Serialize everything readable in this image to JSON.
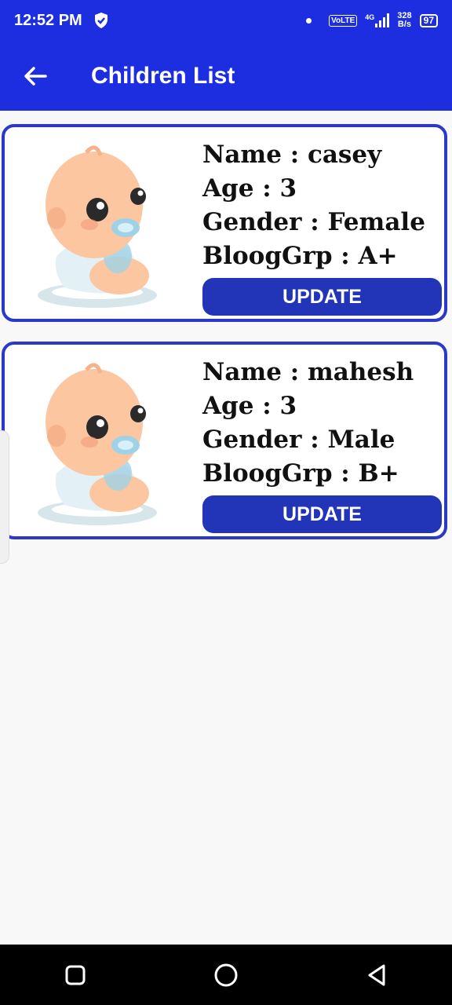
{
  "status_bar": {
    "time": "12:52 PM",
    "volte": "VoLTE",
    "signal_label": "4G",
    "net_speed_value": "328",
    "net_speed_unit": "B/s",
    "battery": "97"
  },
  "app_bar": {
    "title": "Children List"
  },
  "children": [
    {
      "name_line": "Name : casey",
      "age_line": "Age : 3",
      "gender_line": "Gender : Female",
      "blood_line": "BloogGrp : A+",
      "update_label": "UPDATE"
    },
    {
      "name_line": "Name : mahesh",
      "age_line": "Age : 3",
      "gender_line": "Gender : Male",
      "blood_line": "BloogGrp : B+",
      "update_label": "UPDATE"
    }
  ],
  "colors": {
    "primary": "#1c2ee0",
    "button": "#2235b8",
    "card_border": "#2a39cc"
  }
}
